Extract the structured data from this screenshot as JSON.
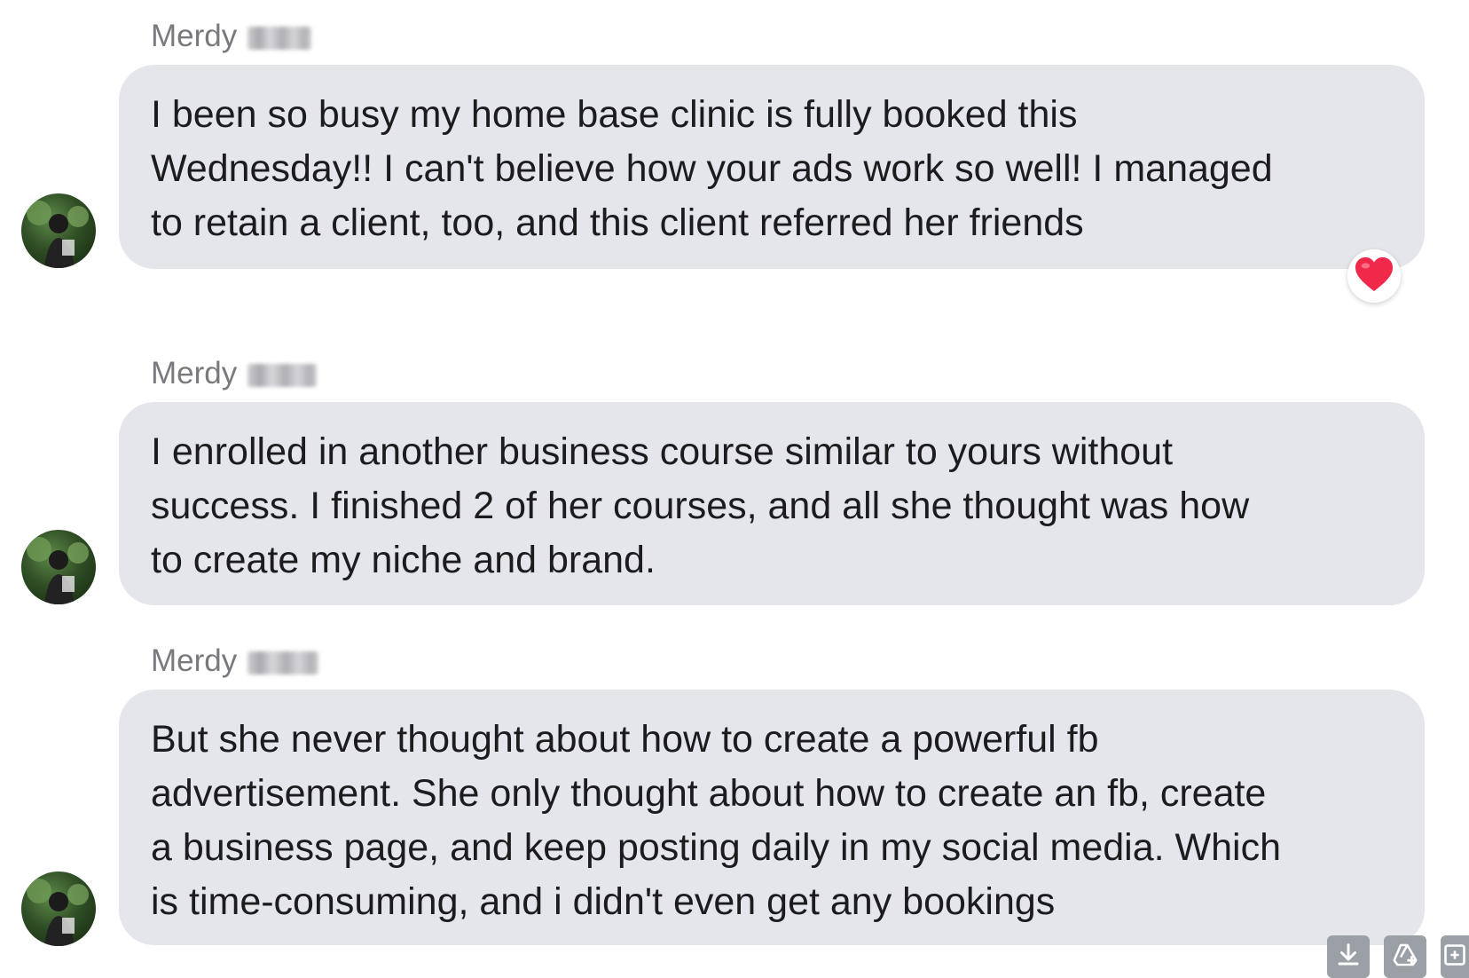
{
  "messages": [
    {
      "sender": "Merdy",
      "text": "I been so busy my home base clinic is fully booked this\nWednesday!! I can't believe how your ads work so well! I managed\nto retain a client, too, and this client referred her friends",
      "reaction": "heart-icon"
    },
    {
      "sender": "Merdy",
      "text": "I enrolled in another business course similar to yours without\nsuccess. I finished 2 of her courses, and all she thought was how\nto create my niche and  brand."
    },
    {
      "sender": "Merdy",
      "text": "But she never thought about how to create a powerful fb\nadvertisement. She only thought about how to create an fb, create\na business page, and keep posting daily in my social media. Which\nis time-consuming, and i didn't even get any bookings"
    }
  ],
  "toolbar": {
    "icons": [
      "download-icon",
      "drive-upload-icon",
      "add-icon"
    ]
  },
  "colors": {
    "bubble": "#e4e6eb",
    "sender_text": "#7a7a7e",
    "message_text": "#1c1c1e",
    "heart": "#f0284a"
  }
}
